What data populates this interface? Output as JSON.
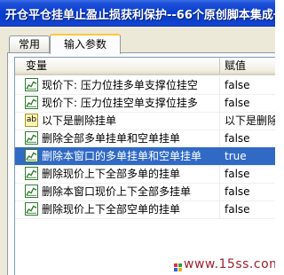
{
  "window": {
    "title": "开仓平仓挂单止盈止损获利保护--66个原创脚本集成一"
  },
  "tabs": [
    {
      "label": "常用"
    },
    {
      "label": "输入参数"
    }
  ],
  "table": {
    "headers": {
      "variable": "变量",
      "value": "赋值"
    },
    "rows": [
      {
        "icon": "chart-icon",
        "label": "现价下: 压力位挂多单支撑位挂空",
        "value": "false",
        "selected": false
      },
      {
        "icon": "chart-icon",
        "label": "现价下: 压力位挂空单支撑位挂多",
        "value": "false",
        "selected": false
      },
      {
        "icon": "ab-icon",
        "icon_text": "ab",
        "label": "以下是删除挂单",
        "value": "以下是删除挂单",
        "selected": false
      },
      {
        "icon": "chart-icon",
        "label": "删除全部多单挂单和空单挂单",
        "value": "false",
        "selected": false
      },
      {
        "icon": "chart-icon",
        "label": "删除本窗口的多单挂单和空单挂单",
        "value": "true",
        "selected": true
      },
      {
        "icon": "chart-icon",
        "label": "删除现价上下全部多单的挂单",
        "value": "false",
        "selected": false
      },
      {
        "icon": "chart-icon",
        "label": "删除本窗口现价上下全部多挂单",
        "value": "false",
        "selected": false
      },
      {
        "icon": "chart-icon",
        "label": "删除现价上下全部空单的挂单",
        "value": "false",
        "selected": false
      }
    ]
  },
  "watermark": {
    "text": "www.15ss.com"
  },
  "colors": {
    "selection": "#316ac5",
    "titlebar": "#0a3cc8",
    "chart_icon": "#2f7d2f"
  }
}
